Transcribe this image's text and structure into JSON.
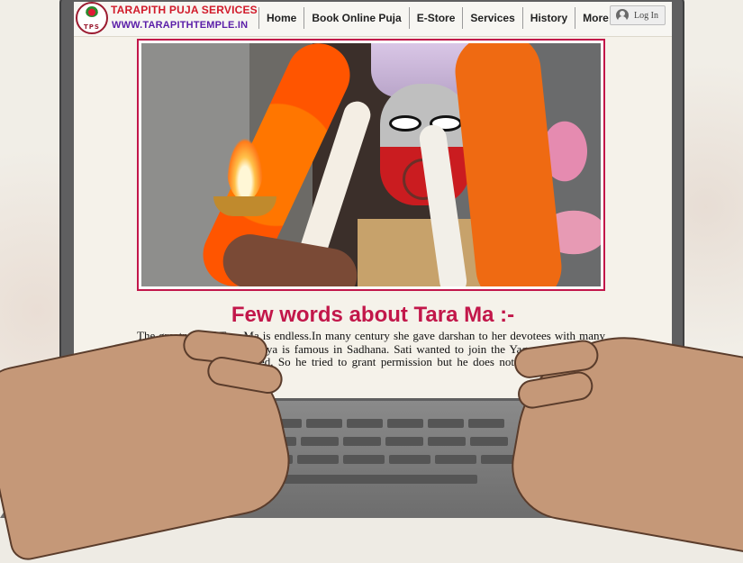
{
  "site": {
    "brand_name": "TARAPITH PUJA SERVICES",
    "brand_url": "WWW.TARAPITHTEMPLE.IN",
    "logo_initials": "TPS"
  },
  "nav": {
    "items": [
      "Home",
      "Book Online Puja",
      "E-Store",
      "Services",
      "History",
      "More"
    ],
    "login_label": "Log In"
  },
  "section": {
    "title": "Few words about Tara Ma :-",
    "body": "The greatness of Tara Ma is endless.In many century she gave darshan to her devotees with many appearance. Dashamahavidya is famous in Sadhana. Sati wanted to join the Yagna of his father, though she was not invited. So he tried to grant permission but he does not agreed. Then Sati showed him"
  },
  "colors": {
    "accent": "#c2174a",
    "brand_red": "#d11a2a",
    "brand_purple": "#5a1ea8"
  }
}
